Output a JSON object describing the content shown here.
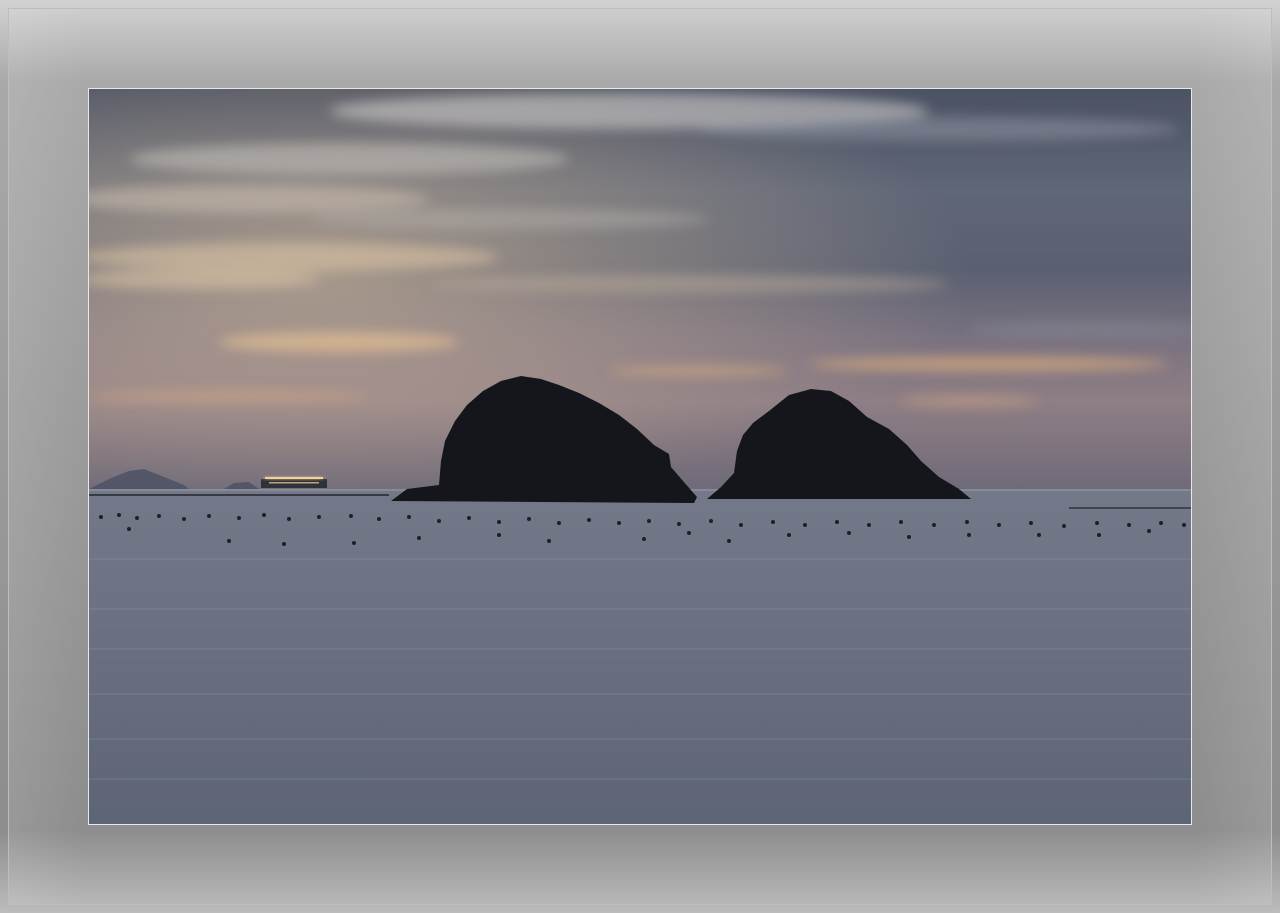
{
  "colors": {
    "frame": "#9a9a9a",
    "sky_top": "#4a5060",
    "sky_glow": "#c9a27f",
    "sea": "#6d7384",
    "silhouette": "#15171c"
  },
  "scene": {
    "elements": [
      "cloudy-sky",
      "island-left",
      "island-right",
      "ship-with-lights",
      "distant-mountains",
      "buoy-rows",
      "calm-sea"
    ]
  }
}
